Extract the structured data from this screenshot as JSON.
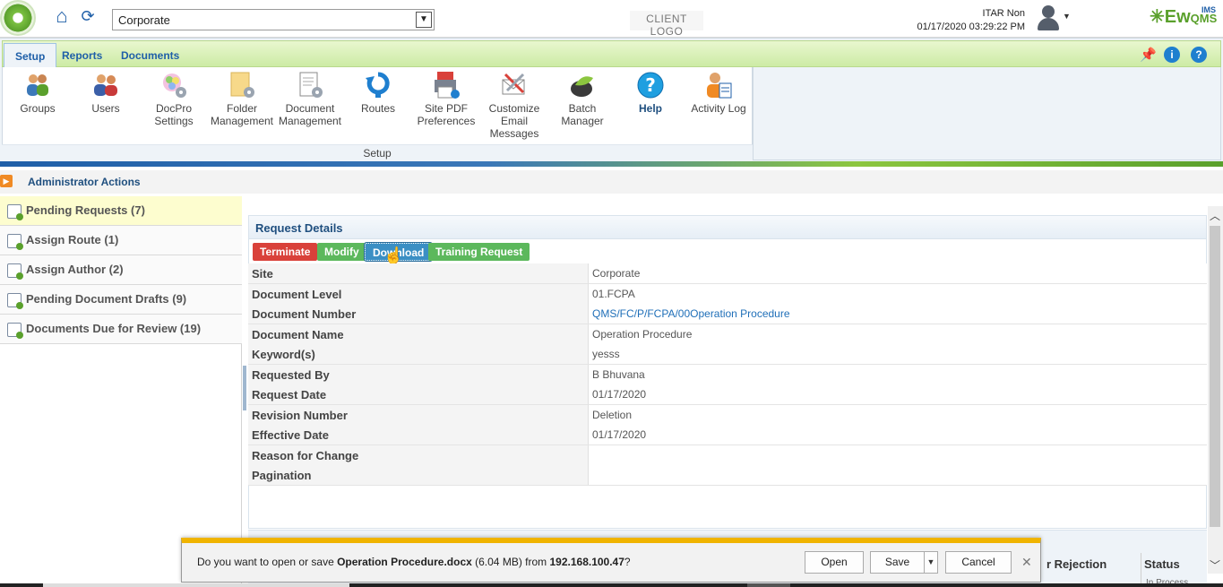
{
  "header": {
    "site": "Corporate",
    "client_logo": "CLIENT LOGO",
    "user_name": "ITAR Non",
    "timestamp": "01/17/2020 03:29:22 PM",
    "brand": "Ew",
    "brand_sub": "IMS",
    "brand_tail": "QMS"
  },
  "ribbon": {
    "tabs": [
      "Setup",
      "Reports",
      "Documents"
    ],
    "active_tab": "Setup",
    "group_label": "Setup",
    "items": [
      {
        "label": "Groups",
        "icon": "groups-icon"
      },
      {
        "label": "Users",
        "icon": "users-icon"
      },
      {
        "label": "DocPro Settings",
        "icon": "docpro-settings-icon"
      },
      {
        "label": "Folder Management",
        "icon": "folder-management-icon"
      },
      {
        "label": "Document Management",
        "icon": "document-management-icon"
      },
      {
        "label": "Routes",
        "icon": "routes-icon"
      },
      {
        "label": "Site PDF Preferences",
        "icon": "site-pdf-preferences-icon"
      },
      {
        "label": "Customize Email Messages",
        "icon": "customize-email-icon"
      },
      {
        "label": "Batch Manager",
        "icon": "batch-manager-icon"
      },
      {
        "label": "Help",
        "icon": "help-icon"
      },
      {
        "label": "Activity Log",
        "icon": "activity-log-icon"
      }
    ]
  },
  "breadcrumb": {
    "text": "Administrator Actions"
  },
  "leftmenu": {
    "items": [
      {
        "label": "Pending Requests (7)",
        "active": true
      },
      {
        "label": "Assign Route (1)"
      },
      {
        "label": "Assign Author (2)"
      },
      {
        "label": "Pending Document Drafts (9)"
      },
      {
        "label": "Documents Due for Review (19)"
      }
    ]
  },
  "request": {
    "title": "Request Details",
    "buttons": {
      "terminate": "Terminate",
      "modify": "Modify",
      "download": "Download",
      "training": "Training Request"
    },
    "rows": [
      {
        "key": "Site",
        "value": "Corporate"
      },
      {
        "key": "Document Level",
        "value": "01.FCPA"
      },
      {
        "key": "Document Number",
        "value": "QMS/FC/P/FCPA/00Operation Procedure"
      },
      {
        "key": "Document Name",
        "value": "Operation Procedure"
      },
      {
        "key": "Keyword(s)",
        "value": "yesss"
      },
      {
        "key": "Requested By",
        "value": "B Bhuvana"
      },
      {
        "key": "Request Date",
        "value": "01/17/2020"
      },
      {
        "key": "Revision Number",
        "value": "Deletion"
      },
      {
        "key": "Effective Date",
        "value": "01/17/2020"
      },
      {
        "key": "Reason for Change",
        "value": ""
      },
      {
        "key": "Pagination",
        "value": ""
      }
    ]
  },
  "lower_table": {
    "col_rejection": "r Rejection",
    "col_status": "Status",
    "status_value": "In Process"
  },
  "download_bar": {
    "prefix": "Do you want to open or save ",
    "filename": "Operation Procedure.docx",
    "size": " (6.04 MB) from ",
    "host": "192.168.100.47",
    "suffix": "?",
    "open": "Open",
    "save": "Save",
    "cancel": "Cancel"
  }
}
